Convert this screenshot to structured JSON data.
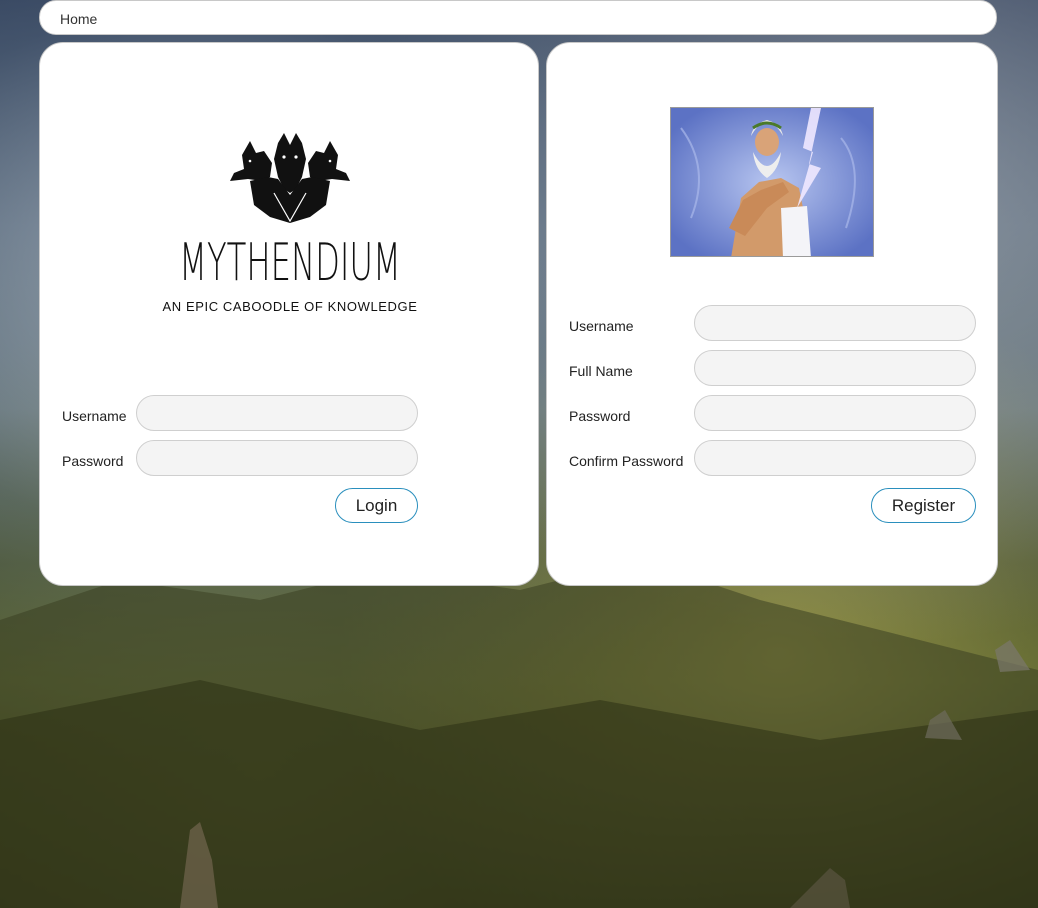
{
  "nav": {
    "home_label": "Home"
  },
  "brand": {
    "title": "MYTHENDIUM",
    "tagline": "AN EPIC CABOODLE OF KNOWLEDGE",
    "logo_icon": "cerberus-logo-icon"
  },
  "login": {
    "username_label": "Username",
    "username_value": "",
    "password_label": "Password",
    "password_value": "",
    "submit_label": "Login"
  },
  "register": {
    "portrait_icon": "zeus-portrait",
    "username_label": "Username",
    "username_value": "",
    "fullname_label": "Full Name",
    "fullname_value": "",
    "password_label": "Password",
    "password_value": "",
    "confirm_label": "Confirm Password",
    "confirm_value": "",
    "submit_label": "Register"
  },
  "colors": {
    "button_border": "#2a8fbd",
    "panel_bg": "#ffffff",
    "input_bg": "#f4f4f4"
  }
}
